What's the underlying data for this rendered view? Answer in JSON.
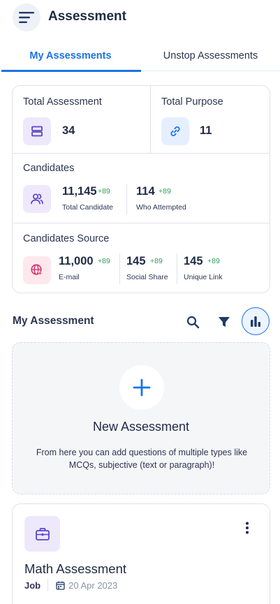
{
  "header": {
    "title": "Assessment",
    "menu_icon": "hamburger-menu-icon"
  },
  "tabs": [
    {
      "label": "My Assessments",
      "active": true
    },
    {
      "label": "Unstop Assessments",
      "active": false
    }
  ],
  "stats": {
    "total_assessment": {
      "label": "Total Assessment",
      "value": "34",
      "icon": "layers-icon"
    },
    "total_purpose": {
      "label": "Total Purpose",
      "value": "11",
      "icon": "link-icon"
    },
    "candidates": {
      "label": "Candidates",
      "icon": "users-icon",
      "items": [
        {
          "value": "11,145",
          "delta": "+89",
          "label": "Total Candidate"
        },
        {
          "value": "114",
          "delta": "+89",
          "label": "Who Attempted"
        }
      ]
    },
    "candidates_source": {
      "label": "Candidates Source",
      "icon": "globe-cursor-icon",
      "items": [
        {
          "value": "11,000",
          "delta": "+89",
          "label": "E-mail"
        },
        {
          "value": "145",
          "delta": "+89",
          "label": "Social Share"
        },
        {
          "value": "145",
          "delta": "+89",
          "label": "Unique Link"
        }
      ]
    }
  },
  "my_assessment": {
    "title": "My Assessment",
    "new_card": {
      "title": "New Assessment",
      "description": "From here you can add questions of multiple types like MCQs, subjective (text or paragraph)!"
    },
    "items": [
      {
        "title": "Math Assessment",
        "type": "Job",
        "date": "20 Apr 2023"
      }
    ]
  },
  "colors": {
    "accent": "#1a73e8",
    "positive": "#2e9e55",
    "text": "#1f2a44"
  }
}
